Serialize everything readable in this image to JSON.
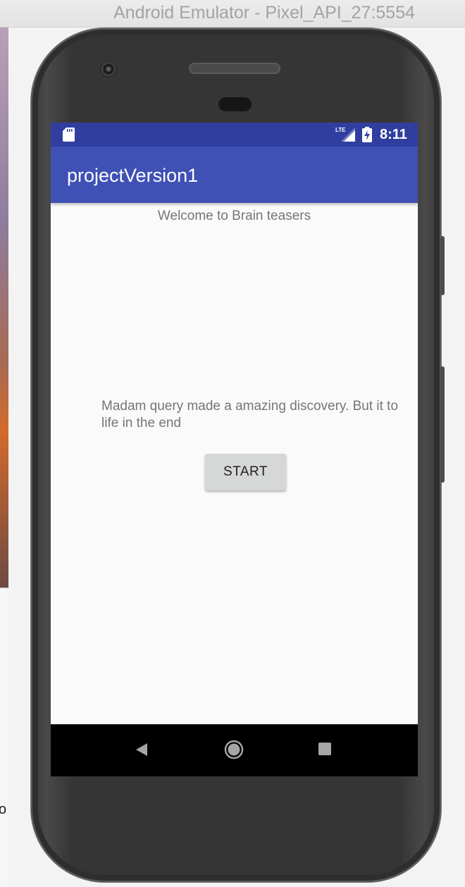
{
  "window": {
    "title": "Android Emulator - Pixel_API_27:5554"
  },
  "desktop": {
    "stray_char": "o"
  },
  "status_bar": {
    "network_label": "LTE",
    "time": "8:11",
    "background": "#303f9f"
  },
  "app_bar": {
    "title": "projectVersion1",
    "background": "#3f51b5"
  },
  "content": {
    "welcome": "Welcome to Brain teasers",
    "story_line1": "Madam query made a amazing discovery. But it to",
    "story_line2": "life in the end",
    "start_button_label": "START"
  },
  "nav_bar": {
    "back_icon": "back-triangle",
    "home_icon": "home-circle",
    "recents_icon": "recents-square"
  }
}
